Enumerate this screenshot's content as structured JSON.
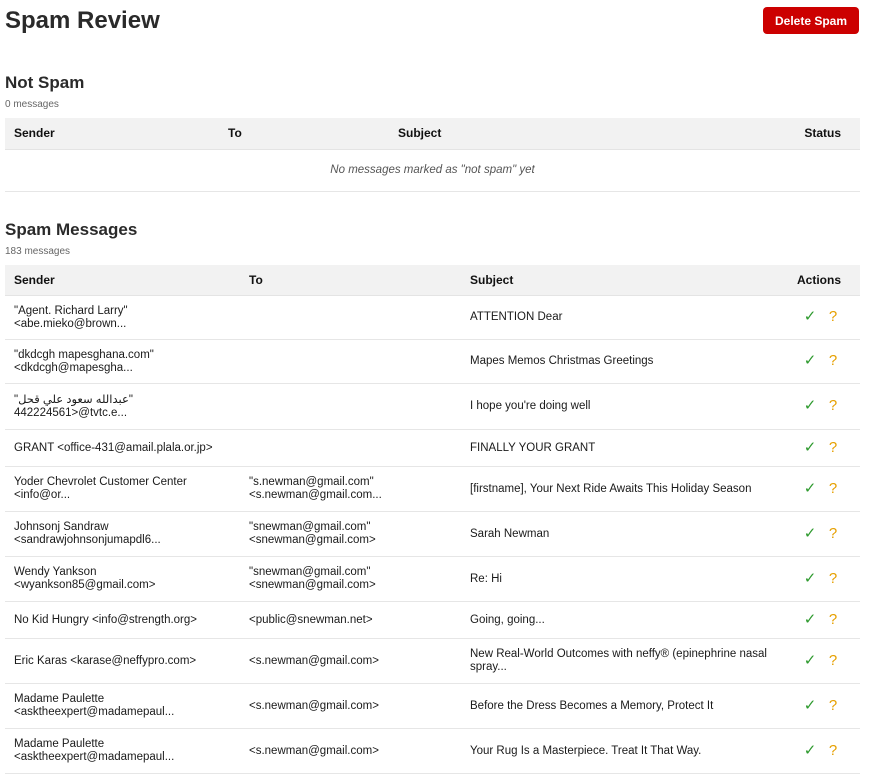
{
  "page": {
    "title": "Spam Review",
    "delete_label": "Delete Spam"
  },
  "not_spam": {
    "title": "Not Spam",
    "count": "0 messages",
    "columns": [
      "Sender",
      "To",
      "Subject",
      "Status"
    ],
    "empty_text": "No messages marked as \"not spam\" yet"
  },
  "spam": {
    "title": "Spam Messages",
    "count": "183 messages",
    "columns": [
      "Sender",
      "To",
      "Subject",
      "Actions"
    ],
    "rows": [
      {
        "sender": [
          "\"Agent. Richard Larry\"",
          "<abe.mieko@brown..."
        ],
        "to": [],
        "subject": [
          "ATTENTION Dear"
        ]
      },
      {
        "sender": [
          "\"dkdcgh mapesghana.com\"",
          "<dkdcgh@mapesgha..."
        ],
        "to": [],
        "subject": [
          "Mapes Memos Christmas Greetings"
        ]
      },
      {
        "sender": [
          "\"عبدالله سعود علي قحل\"",
          "442224561>@tvtc.e..."
        ],
        "to": [],
        "subject": [
          "I hope you're doing well"
        ]
      },
      {
        "sender": [
          "GRANT <office-431@amail.plala.or.jp>"
        ],
        "to": [],
        "subject": [
          "FINALLY YOUR GRANT"
        ]
      },
      {
        "sender": [
          "Yoder Chevrolet Customer Center",
          "<info@or..."
        ],
        "to": [
          "\"s.newman@gmail.com\"",
          "<s.newman@gmail.com..."
        ],
        "subject": [
          "[firstname], Your Next Ride Awaits This Holiday Season"
        ]
      },
      {
        "sender": [
          "Johnsonj Sandraw",
          "<sandrawjohnsonjumapdl6..."
        ],
        "to": [
          "\"snewman@gmail.com\"",
          "<snewman@gmail.com>"
        ],
        "subject": [
          "Sarah Newman"
        ]
      },
      {
        "sender": [
          "Wendy Yankson",
          "<wyankson85@gmail.com>"
        ],
        "to": [
          "\"snewman@gmail.com\"",
          "<snewman@gmail.com>"
        ],
        "subject": [
          "Re: Hi"
        ]
      },
      {
        "sender": [
          "No Kid Hungry <info@strength.org>"
        ],
        "to": [
          "<public@snewman.net>"
        ],
        "subject": [
          "Going, going..."
        ]
      },
      {
        "sender": [
          "Eric Karas <karase@neffypro.com>"
        ],
        "to": [
          "<s.newman@gmail.com>"
        ],
        "subject": [
          "New Real-World Outcomes with neffy® (epinephrine nasal",
          "spray..."
        ]
      },
      {
        "sender": [
          "Madame Paulette",
          "<asktheexpert@madamepaul..."
        ],
        "to": [
          "<s.newman@gmail.com>"
        ],
        "subject": [
          "Before the Dress Becomes a Memory, Protect It"
        ]
      },
      {
        "sender": [
          "Madame Paulette",
          "<asktheexpert@madamepaul..."
        ],
        "to": [
          "<s.newman@gmail.com>"
        ],
        "subject": [
          "Your Rug Is a Masterpiece. Treat It That Way."
        ]
      }
    ],
    "actions": {
      "check_icon": "✓",
      "question_icon": "?"
    }
  },
  "colors": {
    "accent": "#cc0000",
    "check": "#2e9a2e",
    "question": "#e6a000",
    "header_bg": "#f2f2f2"
  }
}
